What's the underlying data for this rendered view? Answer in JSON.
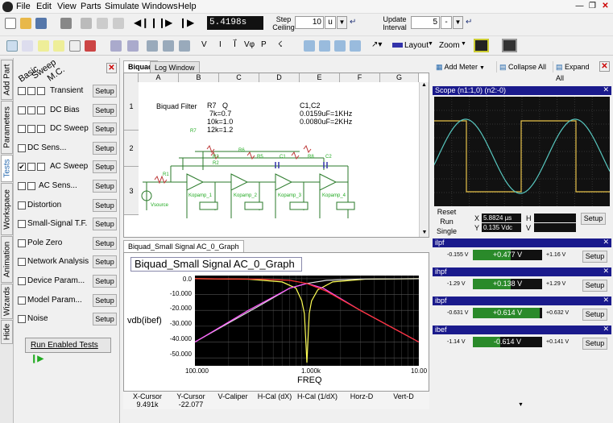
{
  "menu": [
    "File",
    "Edit",
    "View",
    "Parts",
    "Simulate",
    "Windows",
    "Help"
  ],
  "toolbar": {
    "time_display": "5.4198s",
    "step_ceiling_label": "Step\nCeiling",
    "step_value": "10",
    "step_unit": "u",
    "update_interval_label": "Update\nInterval",
    "update_value": "5",
    "update_unit": "-"
  },
  "toolbar2": {
    "layout_label": "Layout",
    "zoom_label": "Zoom"
  },
  "side_tabs": [
    "Add Part",
    "Parameters",
    "Tests",
    "Workspace",
    "Animation",
    "Wizards",
    "Hide"
  ],
  "tests": {
    "headers": [
      "Basic",
      "Sweep",
      "M.C."
    ],
    "setup_label": "Setup",
    "rows": [
      {
        "label": "Transient",
        "checked": false,
        "boxes": 3
      },
      {
        "label": "DC Bias",
        "checked": false,
        "boxes": 3
      },
      {
        "label": "DC Sweep",
        "checked": false,
        "boxes": 3
      },
      {
        "label": "DC Sens...",
        "checked": false,
        "boxes": 1
      },
      {
        "label": "AC Sweep",
        "checked": true,
        "boxes": 3
      },
      {
        "label": "AC Sens...",
        "checked": false,
        "boxes": 2
      },
      {
        "label": "Distortion",
        "checked": false,
        "boxes": 1
      },
      {
        "label": "Small-Signal T.F.",
        "checked": false,
        "boxes": 1
      },
      {
        "label": "Pole Zero",
        "checked": false,
        "boxes": 1
      },
      {
        "label": "Network Analysis",
        "checked": false,
        "boxes": 1
      },
      {
        "label": "Device Param...",
        "checked": false,
        "boxes": 1
      },
      {
        "label": "Model  Param...",
        "checked": false,
        "boxes": 1
      },
      {
        "label": "Noise",
        "checked": false,
        "boxes": 1
      }
    ],
    "run_button": "Run Enabled Tests"
  },
  "doc_tabs": {
    "biquad": "Biquad",
    "log": "Log Window"
  },
  "sheet": {
    "cols": [
      "A",
      "B",
      "C",
      "D",
      "E",
      "F",
      "G"
    ],
    "rows": [
      "1",
      "2",
      "3"
    ],
    "notes": {
      "title": "Biquad Filter",
      "r7q_hdr": "R7   Q",
      "r1": "7k=0.7",
      "r2": "10k=1.0",
      "r3": "12k=1.2",
      "c_hdr": "C1,C2",
      "c1": "0.0159uF=1KHz",
      "c2": "0.0080uF=2KHz"
    },
    "parts": {
      "vsource": "Vsource",
      "r1": "R1",
      "r2": "R2",
      "r3": "R3",
      "r5": "R5",
      "r6": "R6",
      "r7": "R7",
      "r8": "R8",
      "c1": "C1",
      "c2": "C2",
      "op1": "Kopamp_1",
      "op2": "Kopamp_2",
      "op3": "Kopamp_3",
      "op4": "Kopamp_4"
    }
  },
  "graph": {
    "tab_label": "Biquad_Small Signal AC_0_Graph",
    "title": "Biquad_Small Signal AC_0_Graph",
    "ylabel": "vdb(ibef)",
    "xlabel": "FREQ",
    "yticks": [
      "0.0",
      "-10.000",
      "-20.000",
      "-30.000",
      "-40.000",
      "-50.000"
    ],
    "xticks": [
      "100.000",
      "1.000k",
      "10.00"
    ]
  },
  "chart_data": {
    "type": "line",
    "title": "Biquad_Small Signal AC_0_Graph",
    "xlabel": "FREQ",
    "ylabel": "vdb(ibef)",
    "x_scale": "log",
    "xlim": [
      100,
      10000
    ],
    "ylim": [
      -55,
      2
    ],
    "grid": true,
    "series": [
      {
        "color": "#ffff55",
        "x": [
          100,
          300,
          600,
          800,
          900,
          950,
          1000,
          1050,
          1100,
          1250,
          1700,
          3300,
          10000
        ],
        "y": [
          0,
          -0.3,
          -2,
          -6,
          -14,
          -22,
          -53,
          -22,
          -14,
          -7,
          -2,
          -0.3,
          0
        ]
      },
      {
        "color": "#e0e0e0",
        "x": [
          100,
          200,
          400,
          700,
          1000,
          1500,
          3000,
          10000
        ],
        "y": [
          -40,
          -28,
          -16,
          -6,
          -3,
          -1,
          -0.2,
          0
        ]
      },
      {
        "color": "#ff55ff",
        "x": [
          100,
          300,
          700,
          1000,
          1400,
          3000,
          10000
        ],
        "y": [
          -40,
          -20,
          -6,
          -3,
          -6,
          -20,
          -40
        ]
      },
      {
        "color": "#ff3333",
        "x": [
          100,
          400,
          700,
          1000,
          1500,
          3000,
          10000
        ],
        "y": [
          0,
          -0.3,
          -1,
          -3,
          -8,
          -20,
          -40
        ]
      }
    ]
  },
  "cursor": {
    "headers": [
      "X-Cursor",
      "Y-Cursor",
      "V-Caliper",
      "H-Cal (dX)",
      "H-Cal (1/dX)",
      "Horz-D",
      "Vert-D"
    ],
    "x_value": "9.491k",
    "y_value": "-22.077"
  },
  "right": {
    "add_meter": "Add Meter",
    "collapse_all": "Collapse All",
    "expand_all": "Expand All",
    "scope_title": "Scope (n1:1,0) (n2:-0)",
    "reset": "Reset",
    "run": "Run",
    "single": "Single",
    "x_label": "X",
    "x_value": "5.8824 µs",
    "y_label": "Y",
    "y_value": "0.135 Vdc",
    "h_label": "H",
    "v_label": "V",
    "setup": "Setup",
    "meters": [
      {
        "name": "ilpf",
        "min": "-0.155 V",
        "value": "+0.477  V",
        "max": "+1.16 V",
        "fill": 0.55
      },
      {
        "name": "ihpf",
        "min": "-1.29 V",
        "value": "+0.138  V",
        "max": "+1.29 V",
        "fill": 0.55
      },
      {
        "name": "ibpf",
        "min": "-0.631 V",
        "value": "+0.614  V",
        "max": "+0.632 V",
        "fill": 0.97
      },
      {
        "name": "ibef",
        "min": "-1.14 V",
        "value": "-0.614  V",
        "max": "+0.141 V",
        "fill": 0.4
      }
    ]
  }
}
